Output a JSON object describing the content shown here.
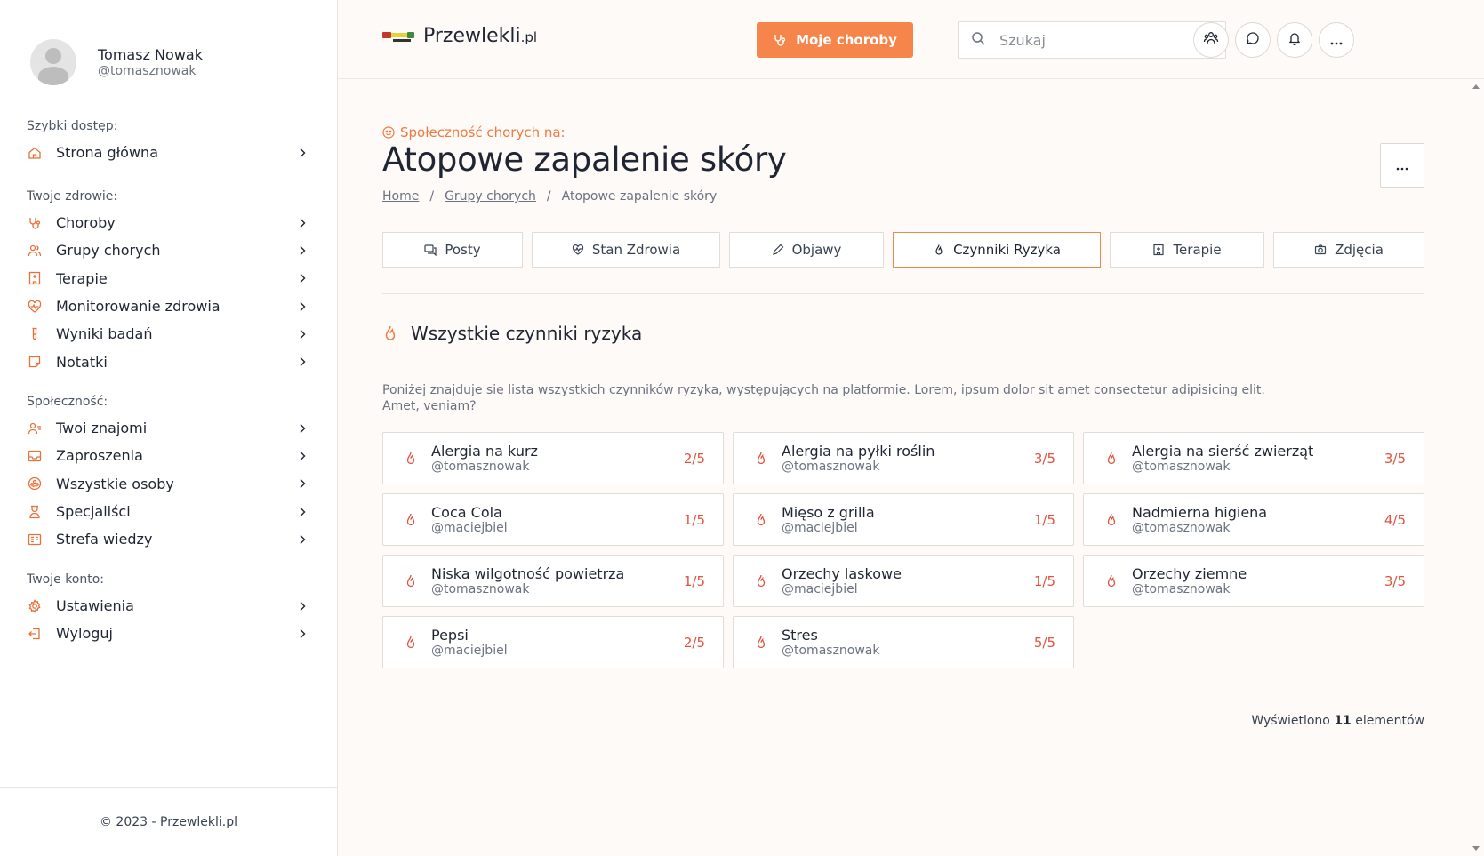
{
  "user": {
    "name": "Tomasz Nowak",
    "handle": "@tomasznowak"
  },
  "sidebar": {
    "sections": [
      {
        "heading": "Szybki dostęp:",
        "items": [
          {
            "label": "Strona główna",
            "icon": "home-icon"
          }
        ]
      },
      {
        "heading": "Twoje zdrowie:",
        "items": [
          {
            "label": "Choroby",
            "icon": "stethoscope-icon"
          },
          {
            "label": "Grupy chorych",
            "icon": "users-icon"
          },
          {
            "label": "Terapie",
            "icon": "hospital-icon"
          },
          {
            "label": "Monitorowanie zdrowia",
            "icon": "heart-pulse-icon"
          },
          {
            "label": "Wyniki badań",
            "icon": "test-tube-icon"
          },
          {
            "label": "Notatki",
            "icon": "note-icon"
          }
        ]
      },
      {
        "heading": "Społeczność:",
        "items": [
          {
            "label": "Twoi znajomi",
            "icon": "user-list-icon"
          },
          {
            "label": "Zaproszenia",
            "icon": "inbox-icon"
          },
          {
            "label": "Wszystkie osoby",
            "icon": "community-icon"
          },
          {
            "label": "Specjaliści",
            "icon": "specialist-icon"
          },
          {
            "label": "Strefa wiedzy",
            "icon": "book-icon"
          }
        ]
      },
      {
        "heading": "Twoje konto:",
        "items": [
          {
            "label": "Ustawienia",
            "icon": "gear-icon"
          },
          {
            "label": "Wyloguj",
            "icon": "logout-icon"
          }
        ]
      }
    ],
    "footer": "© 2023 - Przewlekli.pl"
  },
  "header": {
    "logo_main": "Przewlekli",
    "logo_suffix": ".pl",
    "primary_button": "Moje choroby",
    "search_placeholder": "Szukaj"
  },
  "page": {
    "community_label": "Społeczność chorych na:",
    "title": "Atopowe zapalenie skóry",
    "breadcrumb": [
      "Home",
      "Grupy chorych",
      "Atopowe zapalenie skóry"
    ],
    "tabs": [
      {
        "label": "Posty",
        "icon": "chat-icon",
        "active": false
      },
      {
        "label": "Stan Zdrowia",
        "icon": "health-icon",
        "active": false
      },
      {
        "label": "Objawy",
        "icon": "pen-icon",
        "active": false
      },
      {
        "label": "Czynniki Ryzyka",
        "icon": "flame-icon",
        "active": true
      },
      {
        "label": "Terapie",
        "icon": "hospital-icon",
        "active": false
      },
      {
        "label": "Zdjęcia",
        "icon": "camera-icon",
        "active": false
      }
    ],
    "section_title": "Wszystkie czynniki ryzyka",
    "description": "Poniżej znajduje się lista wszystkich czynników ryzyka, występujących na platformie. Lorem, ipsum dolor sit amet consectetur adipisicing elit. Amet, veniam?",
    "factors": [
      {
        "name": "Alergia na kurz",
        "user": "@tomasznowak",
        "score": "2/5"
      },
      {
        "name": "Alergia na pyłki roślin",
        "user": "@tomasznowak",
        "score": "3/5"
      },
      {
        "name": "Alergia na sierść zwierząt",
        "user": "@tomasznowak",
        "score": "3/5"
      },
      {
        "name": "Coca Cola",
        "user": "@maciejbiel",
        "score": "1/5"
      },
      {
        "name": "Mięso z grilla",
        "user": "@maciejbiel",
        "score": "1/5"
      },
      {
        "name": "Nadmierna higiena",
        "user": "@tomasznowak",
        "score": "4/5"
      },
      {
        "name": "Niska wilgotność powietrza",
        "user": "@tomasznowak",
        "score": "1/5"
      },
      {
        "name": "Orzechy laskowe",
        "user": "@maciejbiel",
        "score": "1/5"
      },
      {
        "name": "Orzechy ziemne",
        "user": "@tomasznowak",
        "score": "3/5"
      },
      {
        "name": "Pepsi",
        "user": "@maciejbiel",
        "score": "2/5"
      },
      {
        "name": "Stres",
        "user": "@tomasznowak",
        "score": "5/5"
      }
    ],
    "count_prefix": "Wyświetlono",
    "count_value": "11",
    "count_suffix": "elementów"
  },
  "colors": {
    "accent": "#f5854a",
    "score": "#e2523f",
    "background": "#fdfaf7"
  }
}
